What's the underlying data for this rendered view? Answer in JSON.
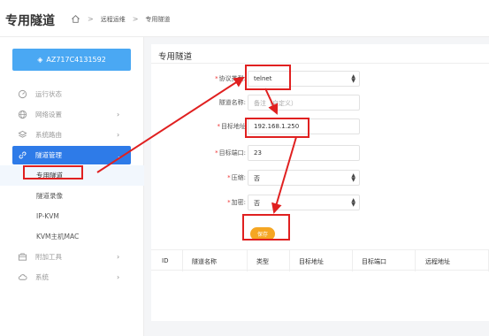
{
  "app": {
    "brand": "专用隧道"
  },
  "breadcrumb": {
    "items": [
      "远程运维",
      "专用隧道"
    ]
  },
  "device": {
    "name": "AZ717C4131592"
  },
  "sidebar": {
    "items": [
      {
        "label": "运行状态",
        "icon": "gauge-icon",
        "chevron": false
      },
      {
        "label": "网络设置",
        "icon": "globe-icon",
        "chevron": true
      },
      {
        "label": "系统路由",
        "icon": "layers-icon",
        "chevron": true
      },
      {
        "label": "隧道管理",
        "icon": "link-icon",
        "chevron": true,
        "active": true
      },
      {
        "label": "附加工具",
        "icon": "toolbox-icon",
        "chevron": true
      },
      {
        "label": "系统",
        "icon": "cloud-icon",
        "chevron": true
      }
    ],
    "subitems": [
      {
        "label": "专用隧道",
        "selected": true
      },
      {
        "label": "隧道录像"
      },
      {
        "label": "IP-KVM"
      },
      {
        "label": "KVM主机MAC"
      }
    ]
  },
  "card": {
    "title": "专用隧道"
  },
  "form": {
    "protocol": {
      "label": "协议类型:",
      "value": "telnet",
      "required": true
    },
    "tunnel_name": {
      "label": "隧道名称:",
      "placeholder": "备注（自定义）",
      "required": false
    },
    "target_addr": {
      "label": "目标地址",
      "value": "192.168.1.250",
      "required": true
    },
    "target_port": {
      "label": "目标端口:",
      "value": "23",
      "required": true
    },
    "compress": {
      "label": "压缩:",
      "value": "否",
      "required": true
    },
    "encrypt": {
      "label": "加密:",
      "value": "否",
      "required": true
    },
    "save_label": "保存"
  },
  "table": {
    "headers": [
      "ID",
      "隧道名称",
      "类型",
      "目标地址",
      "目标端口",
      "远程地址"
    ]
  },
  "colors": {
    "accent": "#2e7be8",
    "device_button": "#4aa8f3",
    "save_button": "#f5a623",
    "annotation": "#e02020"
  }
}
